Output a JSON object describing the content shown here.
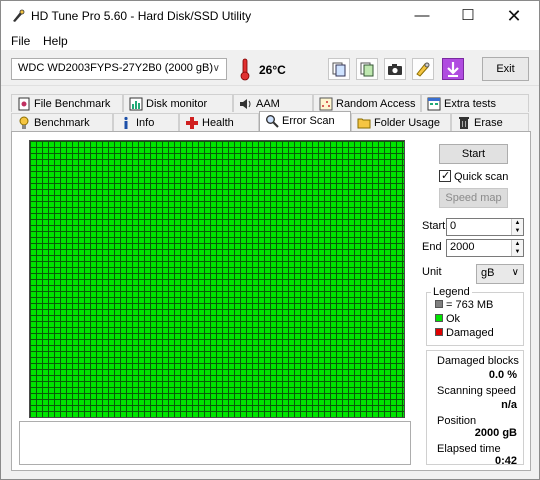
{
  "window": {
    "title": "HD Tune Pro 5.60 - Hard Disk/SSD Utility",
    "minimize": "—",
    "maximize": "☐",
    "close": "✕"
  },
  "menu": {
    "file": "File",
    "help": "Help"
  },
  "toolbar": {
    "drive": "WDC WD2003FYPS-27Y2B0 (2000 gB)",
    "temperature": "26°C",
    "exit": "Exit"
  },
  "tabs_top": [
    "File Benchmark",
    "Disk monitor",
    "AAM",
    "Random Access",
    "Extra tests"
  ],
  "tabs_bottom": [
    "Benchmark",
    "Info",
    "Health",
    "Error Scan",
    "Folder Usage",
    "Erase"
  ],
  "active_tab": "Error Scan",
  "controls": {
    "start": "Start",
    "quick_scan_label": "Quick scan",
    "quick_scan_checked": true,
    "speed_map": "Speed map",
    "start_label": "Start",
    "start_value": "0",
    "end_label": "End",
    "end_value": "2000",
    "unit_label": "Unit",
    "unit_value": "gB"
  },
  "legend": {
    "title": "Legend",
    "block": "= 763 MB",
    "ok": "Ok",
    "damaged": "Damaged",
    "colors": {
      "block": "#808080",
      "ok": "#00e400",
      "damaged": "#e00000"
    }
  },
  "stats": {
    "damaged_blocks_label": "Damaged blocks",
    "damaged_blocks_value": "0.0 %",
    "scanning_speed_label": "Scanning speed",
    "scanning_speed_value": "n/a",
    "position_label": "Position",
    "position_value": "2000 gB",
    "elapsed_label": "Elapsed time",
    "elapsed_value": "0:42"
  },
  "scan_map": {
    "state": "all blocks ok",
    "color": "#00e400"
  }
}
